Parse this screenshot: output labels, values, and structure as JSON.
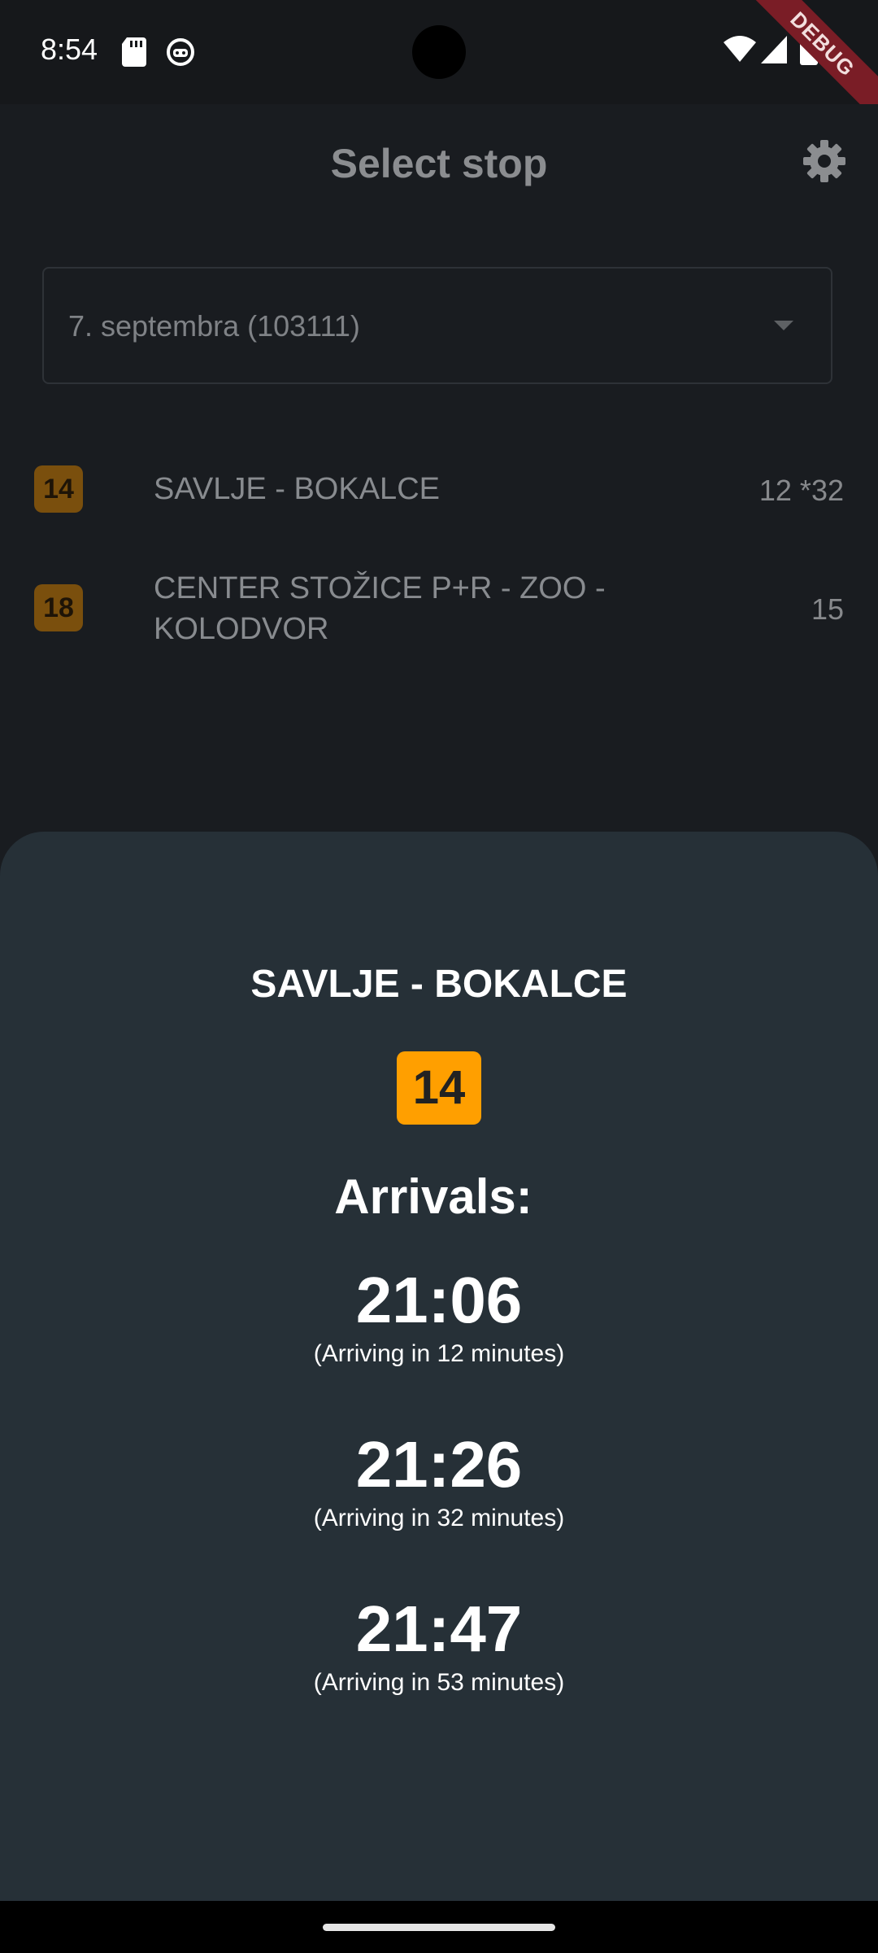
{
  "status_bar": {
    "time": "8:54",
    "icons": [
      "sd-card-icon",
      "cat-face-icon",
      "wifi-icon",
      "signal-icon",
      "battery-icon"
    ],
    "debug_label": "DEBUG"
  },
  "header": {
    "title": "Select stop",
    "settings_icon": "gear-icon"
  },
  "stop_selector": {
    "value": "7. septembra (103111)"
  },
  "routes": [
    {
      "number": "14",
      "name": "SAVLJE - BOKALCE",
      "minutes": "12  *32"
    },
    {
      "number": "18",
      "name": "CENTER STOŽICE P+R - ZOO - KOLODVOR",
      "minutes": "15"
    }
  ],
  "detail_sheet": {
    "title": "SAVLJE - BOKALCE",
    "route_number": "14",
    "arrivals_heading": "Arrivals:",
    "arrivals": [
      {
        "time": "21:06",
        "note": "(Arriving in 12 minutes)"
      },
      {
        "time": "21:26",
        "note": "(Arriving in 32 minutes)"
      },
      {
        "time": "21:47",
        "note": "(Arriving in 53 minutes)"
      }
    ]
  },
  "colors": {
    "accent_orange": "#ff9f00",
    "sheet_background": "#263037",
    "app_background": "#191c20"
  }
}
